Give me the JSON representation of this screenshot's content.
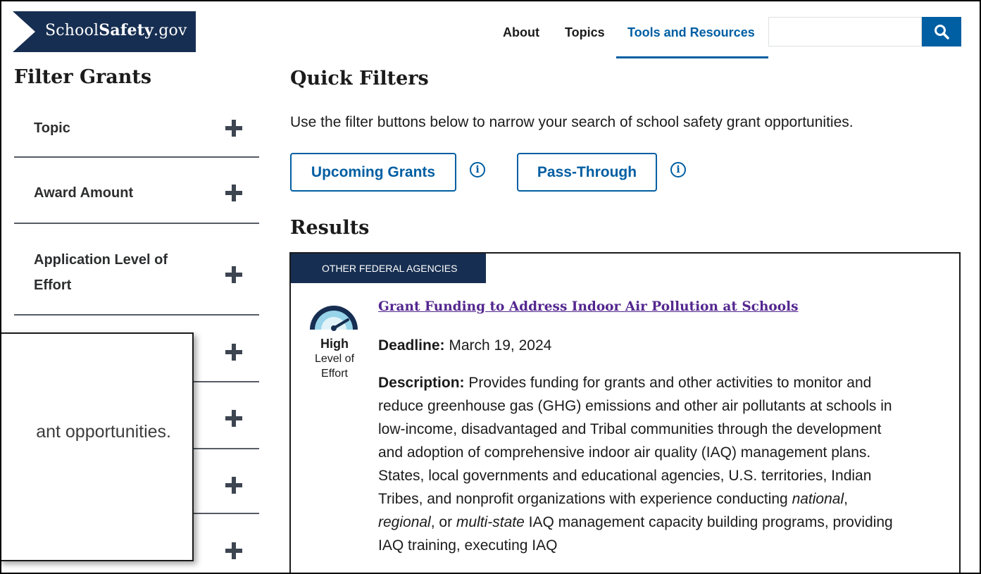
{
  "header": {
    "logo_prefix": "School",
    "logo_bold": "Safety",
    "logo_suffix": ".gov",
    "nav": [
      {
        "label": "About"
      },
      {
        "label": "Topics"
      },
      {
        "label": "Tools and Resources",
        "active": true
      }
    ],
    "search": {
      "value": "",
      "placeholder": "",
      "button_icon": "search-icon"
    }
  },
  "sidebar": {
    "title": "Filter Grants",
    "accordions": [
      {
        "label": "Topic"
      },
      {
        "label": "Award Amount"
      },
      {
        "label": "Application Level of Effort"
      },
      {
        "label": ""
      },
      {
        "label": ""
      },
      {
        "label": ""
      },
      {
        "label": ""
      }
    ]
  },
  "quick_filters": {
    "title": "Quick Filters",
    "description": "Use the filter buttons below to narrow your search of school safety grant opportunities.",
    "buttons": [
      {
        "label": "Upcoming Grants",
        "info_icon": "info-icon"
      },
      {
        "label": "Pass-Through",
        "info_icon": "info-icon"
      }
    ]
  },
  "results": {
    "title": "Results",
    "cards": [
      {
        "tag": "OTHER FEDERAL AGENCIES",
        "effort_level": "High",
        "effort_caption": "Level of Effort",
        "title": "Grant Funding to Address Indoor Air Pollution at Schools",
        "deadline_label": "Deadline:",
        "deadline": "March 19, 2024",
        "description_label": "Description:",
        "description_part1": "Provides funding for grants and other activities to monitor and reduce greenhouse gas (GHG) emissions and other air pollutants at schools in low-income, disadvantaged and Tribal communities through the development and adoption of comprehensive indoor air quality (IAQ) management plans. States, local governments and educational agencies, U.S. territories, Indian Tribes, and nonprofit organizations with experience conducting ",
        "description_em1": "national",
        "description_sep1": ", ",
        "description_em2": "regional",
        "description_sep2": ", or ",
        "description_em3": "multi-state",
        "description_part2": " IAQ management capacity building programs, providing IAQ training, executing IAQ"
      }
    ]
  },
  "zoom_overlay": {
    "text": "ant opportunities."
  },
  "colors": {
    "navy": "#162e51",
    "primary": "#005ea2",
    "visited_link": "#54278f"
  }
}
